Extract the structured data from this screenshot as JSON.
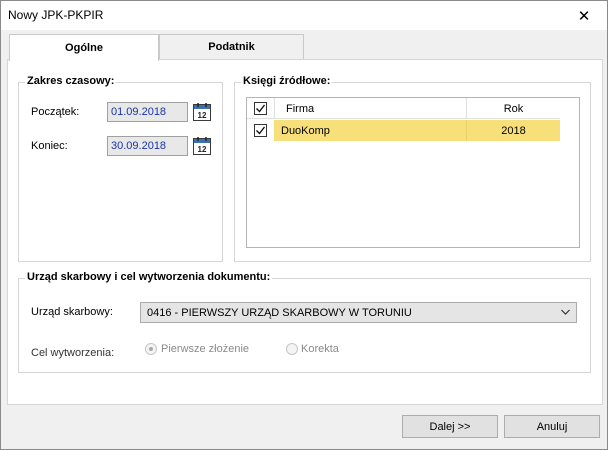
{
  "window": {
    "title": "Nowy JPK-PKPIR",
    "close_glyph": "✕"
  },
  "tabs": [
    {
      "label": "Ogólne",
      "active": true
    },
    {
      "label": "Podatnik",
      "active": false
    }
  ],
  "zakres": {
    "title": "Zakres czasowy:",
    "start_label": "Początek:",
    "start_value": "01.09.2018",
    "end_label": "Koniec:",
    "end_value": "30.09.2018",
    "calendar_day": "12"
  },
  "ksiegi": {
    "title": "Księgi źródłowe:",
    "columns": [
      "Firma",
      "Rok"
    ],
    "rows": [
      {
        "checked": true,
        "firma": "DuoKomp",
        "rok": "2018",
        "selected": true
      }
    ],
    "selected_row_color": "#f7df7a"
  },
  "urzad": {
    "title": "Urząd skarbowy i cel wytworzenia dokumentu:",
    "office_label": "Urząd skarbowy:",
    "office_value": "0416 - PIERWSZY URZĄD SKARBOWY W TORUNIU",
    "purpose_label": "Cel wytworzenia:",
    "purpose_options": [
      {
        "label": "Pierwsze złożenie",
        "selected": true,
        "enabled": false
      },
      {
        "label": "Korekta",
        "selected": false,
        "enabled": false
      }
    ]
  },
  "footer": {
    "next_label": "Dalej >>",
    "cancel_label": "Anuluj"
  }
}
